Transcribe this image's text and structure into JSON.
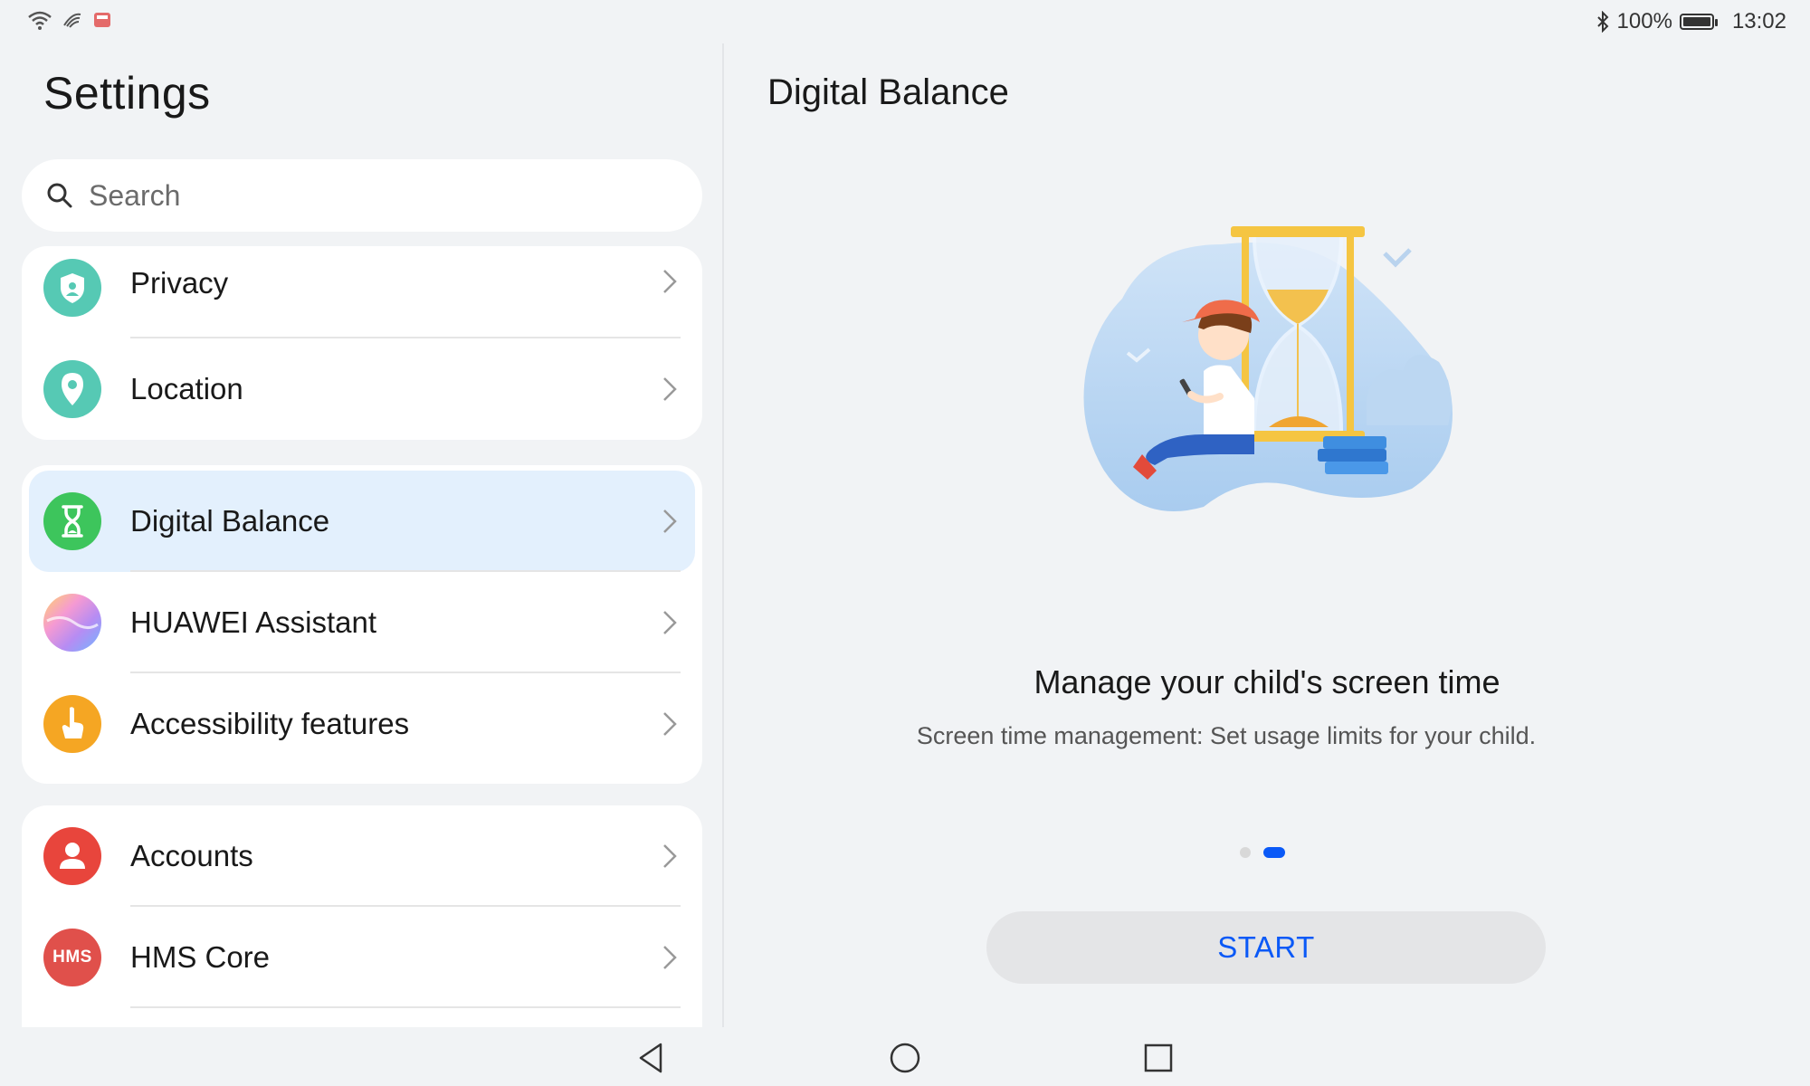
{
  "status_bar": {
    "battery_percent": "100%",
    "time": "13:02"
  },
  "sidebar": {
    "title": "Settings",
    "search": {
      "placeholder": "Search"
    },
    "groups": [
      {
        "items": [
          {
            "label": "Privacy",
            "icon": "shield-person-icon",
            "color": "#56c9b4"
          },
          {
            "label": "Location",
            "icon": "location-pin-icon",
            "color": "#56c9b4"
          }
        ]
      },
      {
        "items": [
          {
            "label": "Digital Balance",
            "icon": "hourglass-icon",
            "color": "#3dc55c",
            "selected": true
          },
          {
            "label": "HUAWEI Assistant",
            "icon": "assistant-orb-icon",
            "color": "#c9a6f0"
          },
          {
            "label": "Accessibility features",
            "icon": "hand-pointer-icon",
            "color": "#f5a623"
          }
        ]
      },
      {
        "items": [
          {
            "label": "Accounts",
            "icon": "person-icon",
            "color": "#e8453c"
          },
          {
            "label": "HMS Core",
            "icon": "hms-icon",
            "icon_text": "HMS",
            "color": "#e0504b"
          }
        ]
      }
    ]
  },
  "main": {
    "title": "Digital Balance",
    "headline": "Manage your child's screen time",
    "description": "Screen time management: Set usage limits for your child.",
    "pager": {
      "count": 2,
      "active": 2
    },
    "start_label": "START",
    "accent": "#0a59f7"
  },
  "nav": {
    "back": "back-icon",
    "home": "home-icon",
    "recents": "recents-icon"
  }
}
